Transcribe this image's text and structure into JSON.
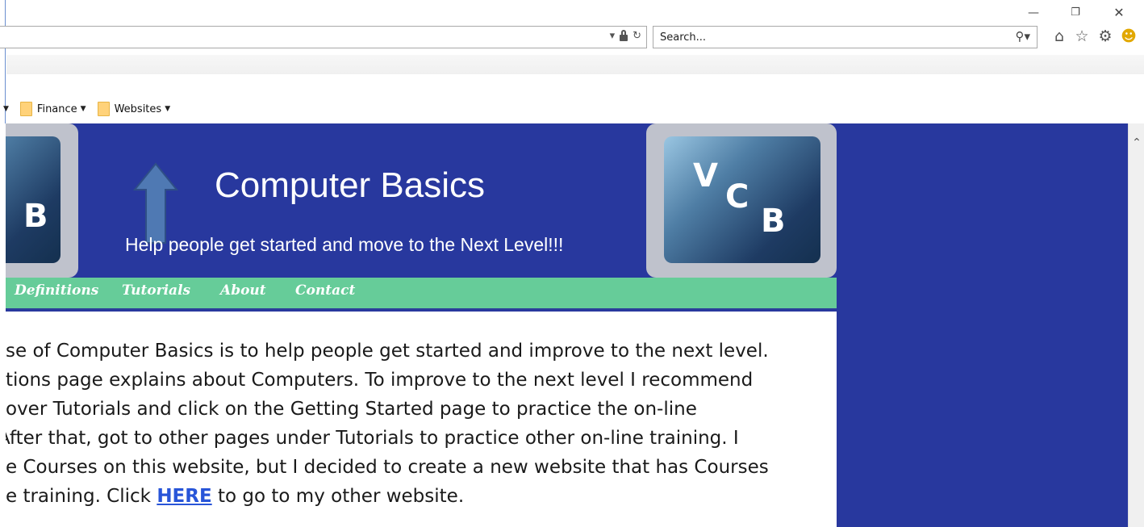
{
  "browser": {
    "search_placeholder": "Search...",
    "favorites": [
      {
        "label": "Finance"
      },
      {
        "label": "Websites"
      }
    ],
    "icons": [
      "minimize-icon",
      "restore-icon",
      "close-icon",
      "dropdown-icon",
      "lock-icon",
      "refresh-icon",
      "search-icon",
      "home-icon",
      "star-icon",
      "gear-icon",
      "smiley-icon",
      "folder-icon",
      "scroll-up-icon"
    ]
  },
  "site": {
    "title": "Computer Basics",
    "tagline": "Help people get started and move to the Next Level!!!",
    "logo_left": {
      "letters": [
        "B"
      ]
    },
    "logo_right": {
      "letters": [
        "V",
        "C",
        "B"
      ]
    },
    "nav": [
      {
        "label": "Definitions"
      },
      {
        "label": "Tutorials"
      },
      {
        "label": "About"
      },
      {
        "label": "Contact"
      }
    ],
    "content": {
      "lines": [
        "se of Computer Basics is to help people get started and improve to the next level.",
        "tions page explains about Computers.  To improve to the next level I recommend",
        "over Tutorials and click on the Getting Started page to practice the on-line",
        "After that, got to other pages under Tutorials to practice other on-line training.  I",
        "e Courses on this website, but I decided to create a new website that has Courses"
      ],
      "last_line_before": "e training.  Click ",
      "link_label": "HERE",
      "last_line_after": " to go to my other website."
    },
    "colors": {
      "header_bg": "#28389e",
      "nav_bg": "#66cc99",
      "link": "#2855d8"
    }
  }
}
